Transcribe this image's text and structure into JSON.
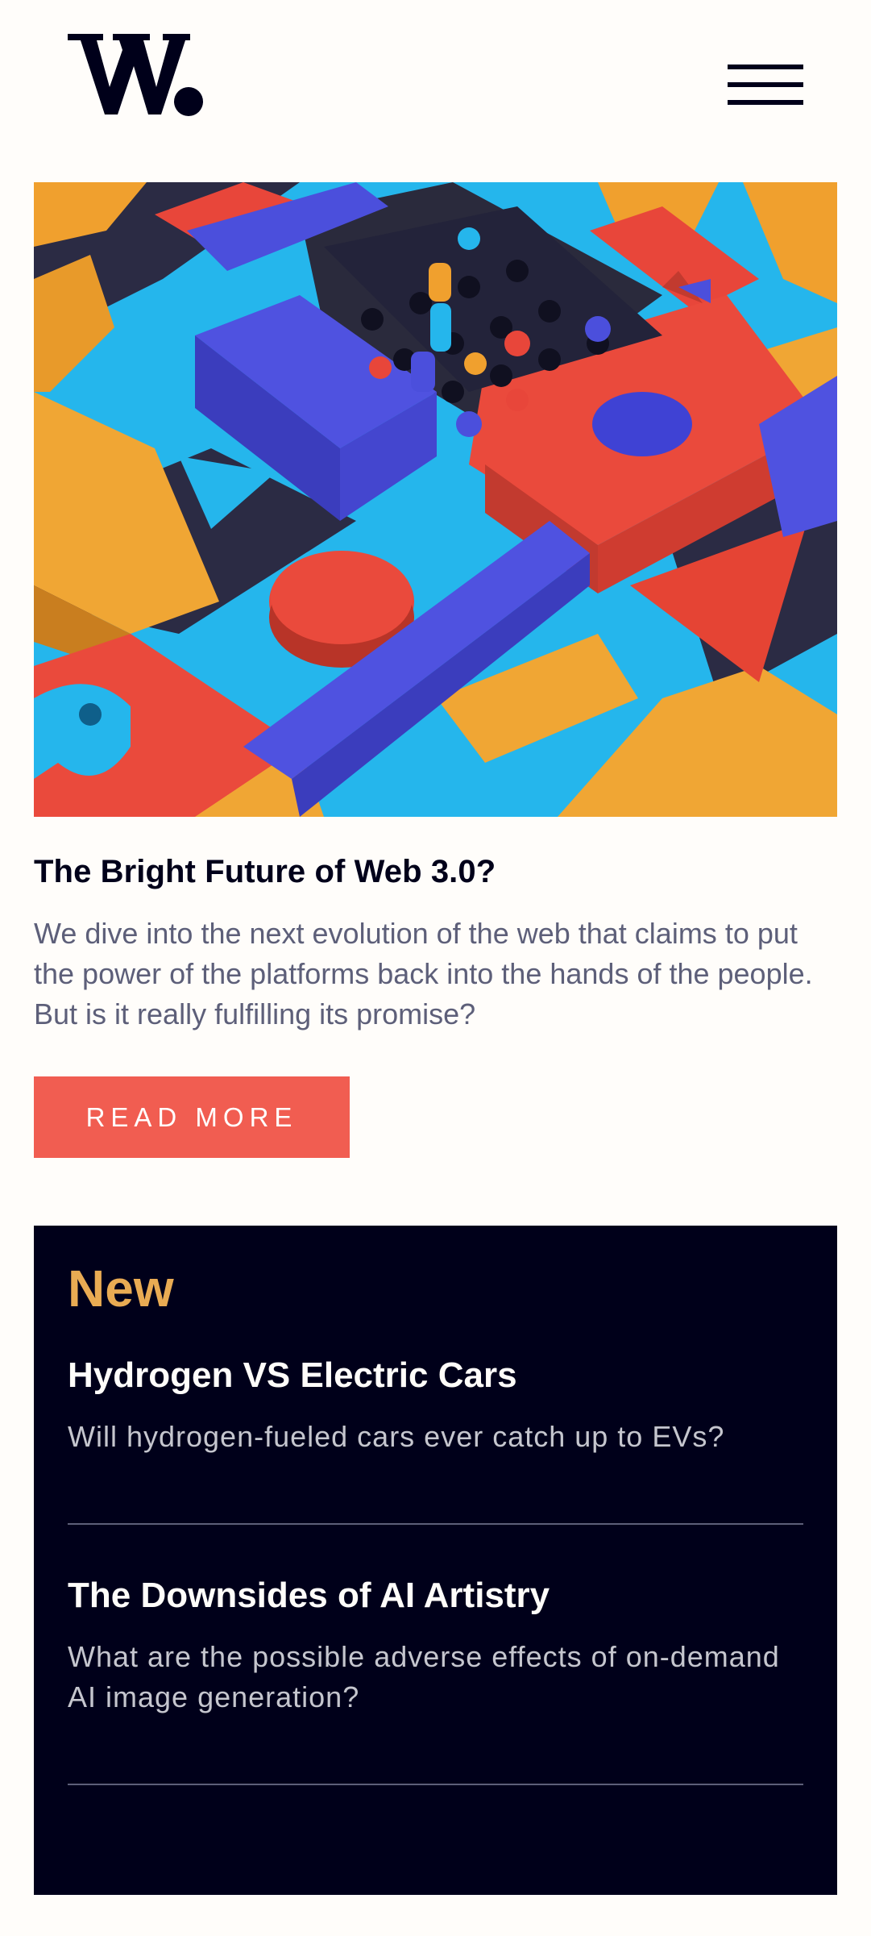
{
  "header": {
    "logo_alt": "W.",
    "menu_icon": "hamburger-menu-icon"
  },
  "hero": {
    "image_desc_icon": "abstract-3d-shapes-image"
  },
  "article": {
    "title": "The Bright Future of Web 3.0?",
    "summary": "We dive into the next evolution of the web that claims to put the power of the platforms back into the hands of the people. But is it really fulfilling its promise?",
    "cta_label": "READ MORE"
  },
  "new_section": {
    "heading": "New",
    "items": [
      {
        "title": "Hydrogen VS Electric Cars",
        "text": "Will hydrogen-fueled cars ever catch up to EVs?"
      },
      {
        "title": "The Downsides of AI Artistry",
        "text": "What are the possible adverse effects of on-demand AI image generation?"
      }
    ]
  },
  "colors": {
    "background": "#fffdfa",
    "dark_navy": "#00001a",
    "soft_red": "#f15d51",
    "soft_orange": "#e9ab53",
    "grayish_blue": "#5d5f79"
  }
}
